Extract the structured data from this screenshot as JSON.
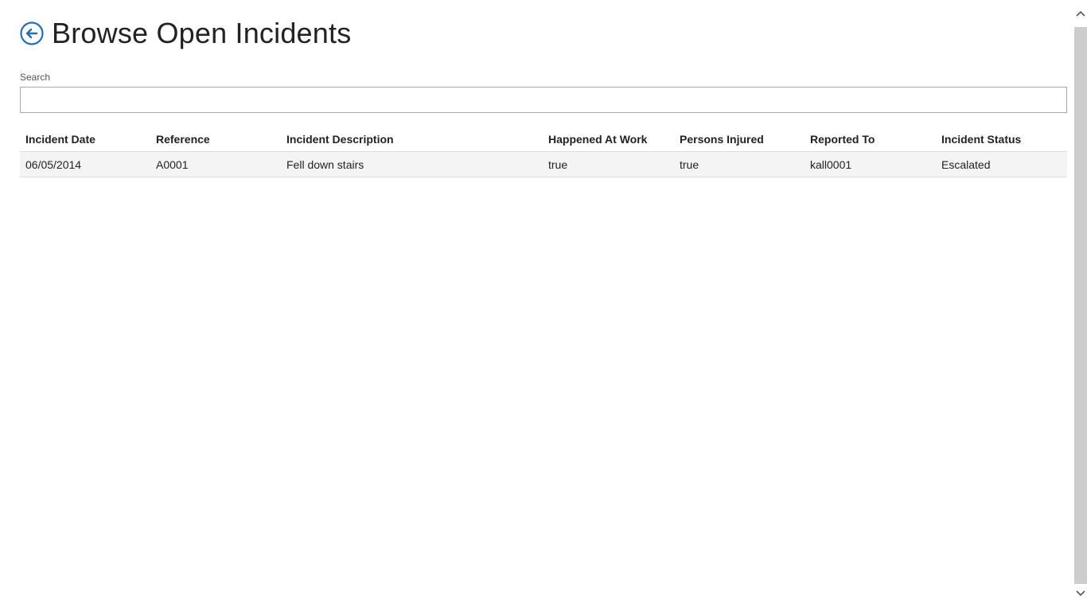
{
  "header": {
    "title": "Browse Open Incidents",
    "back_icon": "back-arrow-circle-icon"
  },
  "search": {
    "label": "Search",
    "value": "",
    "placeholder": ""
  },
  "table": {
    "columns": [
      "Incident Date",
      "Reference",
      "Incident Description",
      "Happened At Work",
      "Persons Injured",
      "Reported To",
      "Incident Status"
    ],
    "rows": [
      [
        "06/05/2014",
        "A0001",
        "Fell down stairs",
        "true",
        "true",
        "kall0001",
        "Escalated"
      ]
    ]
  },
  "colors": {
    "accent": "#1f6fb5",
    "row_background": "#f4f4f4",
    "scrollbar_track": "#cdcdcd"
  }
}
